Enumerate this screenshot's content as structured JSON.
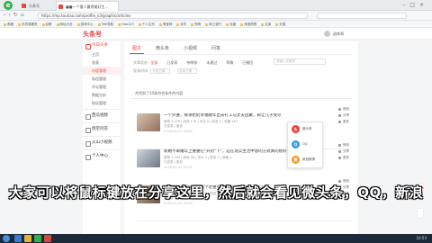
{
  "browser": {
    "logo_letter": "e",
    "tabs": [
      {
        "label": "头条号"
      },
      {
        "label": "■■一个傻人赢得美好生..."
      }
    ],
    "url": "https://mp.toutiao.com/profile_v3/graphic/articles",
    "bookmarks": [
      "收藏",
      "手机收藏夹",
      "谷歌",
      "网址大全",
      "游戏中心",
      "360导航",
      "Hao123",
      "个人主页",
      "淘宝网",
      "京东",
      "购物",
      "网上银行",
      "百度",
      "淘宝购物",
      "文库",
      "天猫"
    ]
  },
  "site": {
    "logo": "头条号",
    "user_name": "退休哥"
  },
  "sidebar": {
    "groups": [
      {
        "label": "今日头条",
        "items": [
          "主页",
          "发表",
          "内容管理",
          "私信管理",
          "评论管理",
          "数据分析",
          "粉丝管理"
        ],
        "active": "内容管理"
      },
      {
        "label": "西瓜视频"
      },
      {
        "label": "悟空问答"
      },
      {
        "label": "火山小视频"
      },
      {
        "label": "个人中心"
      }
    ]
  },
  "main": {
    "tabs": [
      "图文",
      "微头条",
      "小视频",
      "问答"
    ],
    "active_tab": "图文",
    "filter_label": "文章状态",
    "filters": [
      "全部",
      "已发表",
      "待审核",
      "未通过",
      "草稿",
      "已撤回"
    ],
    "active_filter": "全部",
    "time_label": "发表时间",
    "date_start": "开始日期",
    "date_end": "结束日期",
    "search_placeholder": "请输入关键词",
    "count_text": "共找到了10条符合条件的内容"
  },
  "articles": [
    {
      "title": "一个外婆，继承奶奶享福晚年出去打工与丈夫团聚，却让儿子受尽",
      "meta": "推荐 3,076 | 阅读 178 | 评论 0 | 转发 5 | 收藏 167",
      "meta2": "已发表 | 原创",
      "date": "2018-04-07 09:09"
    },
    {
      "title": "新婚不离婚以上婆婆在\"开药\"下\"，这在现实生活中总的方式真的很好？",
      "meta": "推荐 1,264 | 阅读 56 | 评论 0 | 转发 0 | 收藏 4",
      "meta2": "已发表 | 原创",
      "date": "2018-04-05 09:44"
    },
    {
      "title": "这位婆婆事话说她，百个老婆不要拿钱，你没有不能么？",
      "meta": "推荐 1,512 | 阅读 96 | 评论 2 | 转发 1 | 收藏 20",
      "meta2": "已发表 | 原创",
      "date": "2018-04-05 09:09"
    }
  ],
  "article_actions": [
    "修改",
    "分享",
    "更多"
  ],
  "share_popup": {
    "options": [
      {
        "label": "微头条",
        "icon": "toutiao-icon",
        "letter": "头",
        "color": "#ed4040"
      },
      {
        "label": "QQ",
        "icon": "qq-icon",
        "letter": "Q",
        "color": "#2f9ee8"
      },
      {
        "label": "新浪微博",
        "icon": "weibo-icon",
        "letter": "微",
        "color": "#f59a23"
      }
    ]
  },
  "subtitle": "大家可以将鼠标键放在分享这里，然后就会看见微头条，QQ，新浪",
  "taskbar": {
    "clock": "10:53"
  }
}
